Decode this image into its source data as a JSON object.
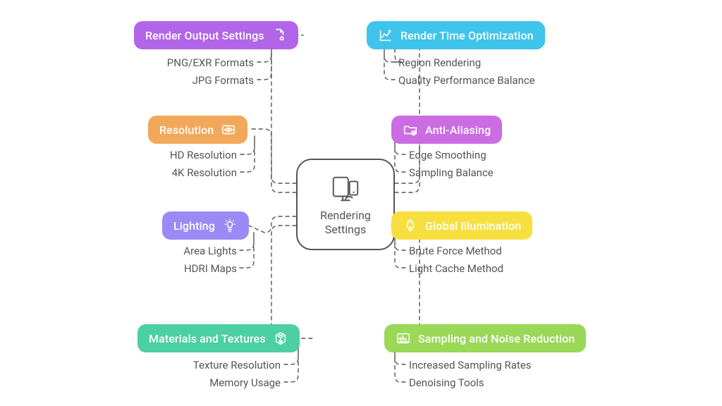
{
  "center": {
    "label": "Rendering\nSettings"
  },
  "colors": {
    "purpleA": "#b265e8",
    "orange": "#f2a85a",
    "lavender": "#9b8af6",
    "teal": "#4bcfa3",
    "cyan": "#3fc4ec",
    "magenta": "#cb6ce3",
    "yellow": "#f7df40",
    "lime": "#9ad858"
  },
  "left": {
    "render_output": {
      "label": "Render Output Settings",
      "subs": [
        "PNG/EXR Formats",
        "JPG Formats"
      ]
    },
    "resolution": {
      "label": "Resolution",
      "subs": [
        "HD Resolution",
        "4K Resolution"
      ]
    },
    "lighting": {
      "label": "Lighting",
      "subs": [
        "Area Lights",
        "HDRI Maps"
      ]
    },
    "materials": {
      "label": "Materials and Textures",
      "subs": [
        "Texture Resolution",
        "Memory Usage"
      ]
    }
  },
  "right": {
    "render_time": {
      "label": "Render Time Optimization",
      "subs": [
        "Region Rendering",
        "Quality Performance Balance"
      ]
    },
    "anti_aliasing": {
      "label": "Anti-Aliasing",
      "subs": [
        "Edge Smoothing",
        "Sampling Balance"
      ]
    },
    "global_illum": {
      "label": "Global Illumination",
      "subs": [
        "Brute Force Method",
        "Light Cache Method"
      ]
    },
    "sampling": {
      "label": "Sampling and Noise Reduction",
      "subs": [
        "Increased Sampling Rates",
        "Denoising Tools"
      ]
    }
  }
}
